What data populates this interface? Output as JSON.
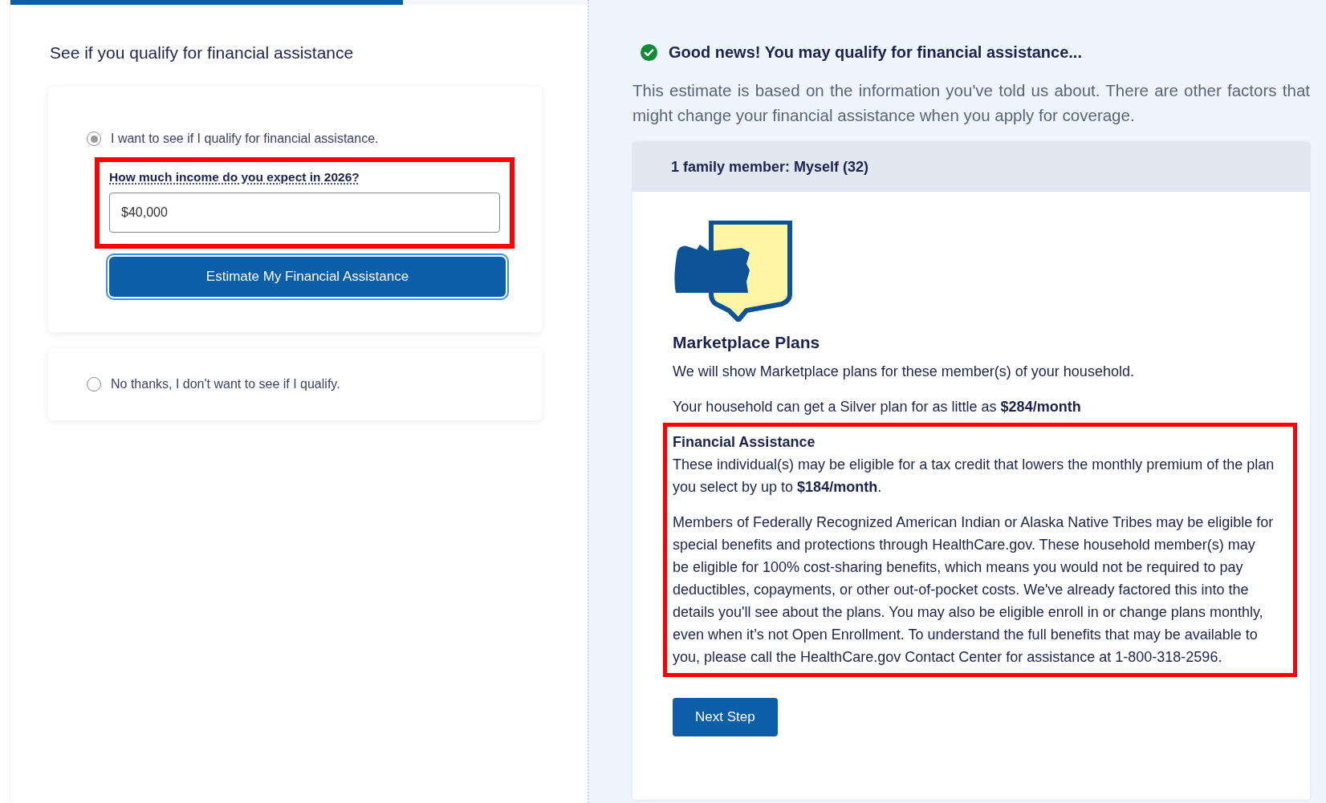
{
  "progress": {
    "level": 0.68
  },
  "left": {
    "title": "See if you qualify for financial assistance",
    "options": [
      {
        "label": "I want to see if I qualify for financial assistance.",
        "selected": true,
        "income_question": "How much income do you expect in 2026?",
        "income_value": "$40,000",
        "button": "Estimate My Financial Assistance",
        "highlighted": true
      },
      {
        "label": "No thanks, I don't want to see if I qualify.",
        "selected": false
      }
    ]
  },
  "right": {
    "heading": "Good news! You may qualify for financial assistance...",
    "intro": "This estimate is based on the information you've told us about. There are other factors that might change your financial assistance when you apply for coverage.",
    "card": {
      "header": "1 family member: Myself (32)",
      "plan_title": "Marketplace Plans",
      "plan_text": "We will show Marketplace plans for these member(s) of your household.",
      "price_text": "Your household can get a Silver plan for as little as **$284/month**",
      "assistance_title": "Financial Assistance",
      "assistance_text": "These individual(s) may be eligible for a tax credit that lowers the monthly premium of the plan you select by up to **$184/month**.",
      "tribes_text": "Members of Federally Recognized American Indian or Alaska Native Tribes may be eligible for special benefits and protections through HealthCare.gov. These household member(s) may be eligible for 100% cost-sharing benefits, which means you would not be required to pay deductibles, copayments, or other out-of-pocket costs. We've already factored this into the details you'll see about the plans. You may also be eligible enroll in or change plans monthly, even when it’s not Open Enrollment. To understand the full benefits that may be available to you, please call the HealthCare.gov Contact Center for assistance at 1-800-318-2596.",
      "highlighted": true,
      "button": "Next Step"
    }
  }
}
